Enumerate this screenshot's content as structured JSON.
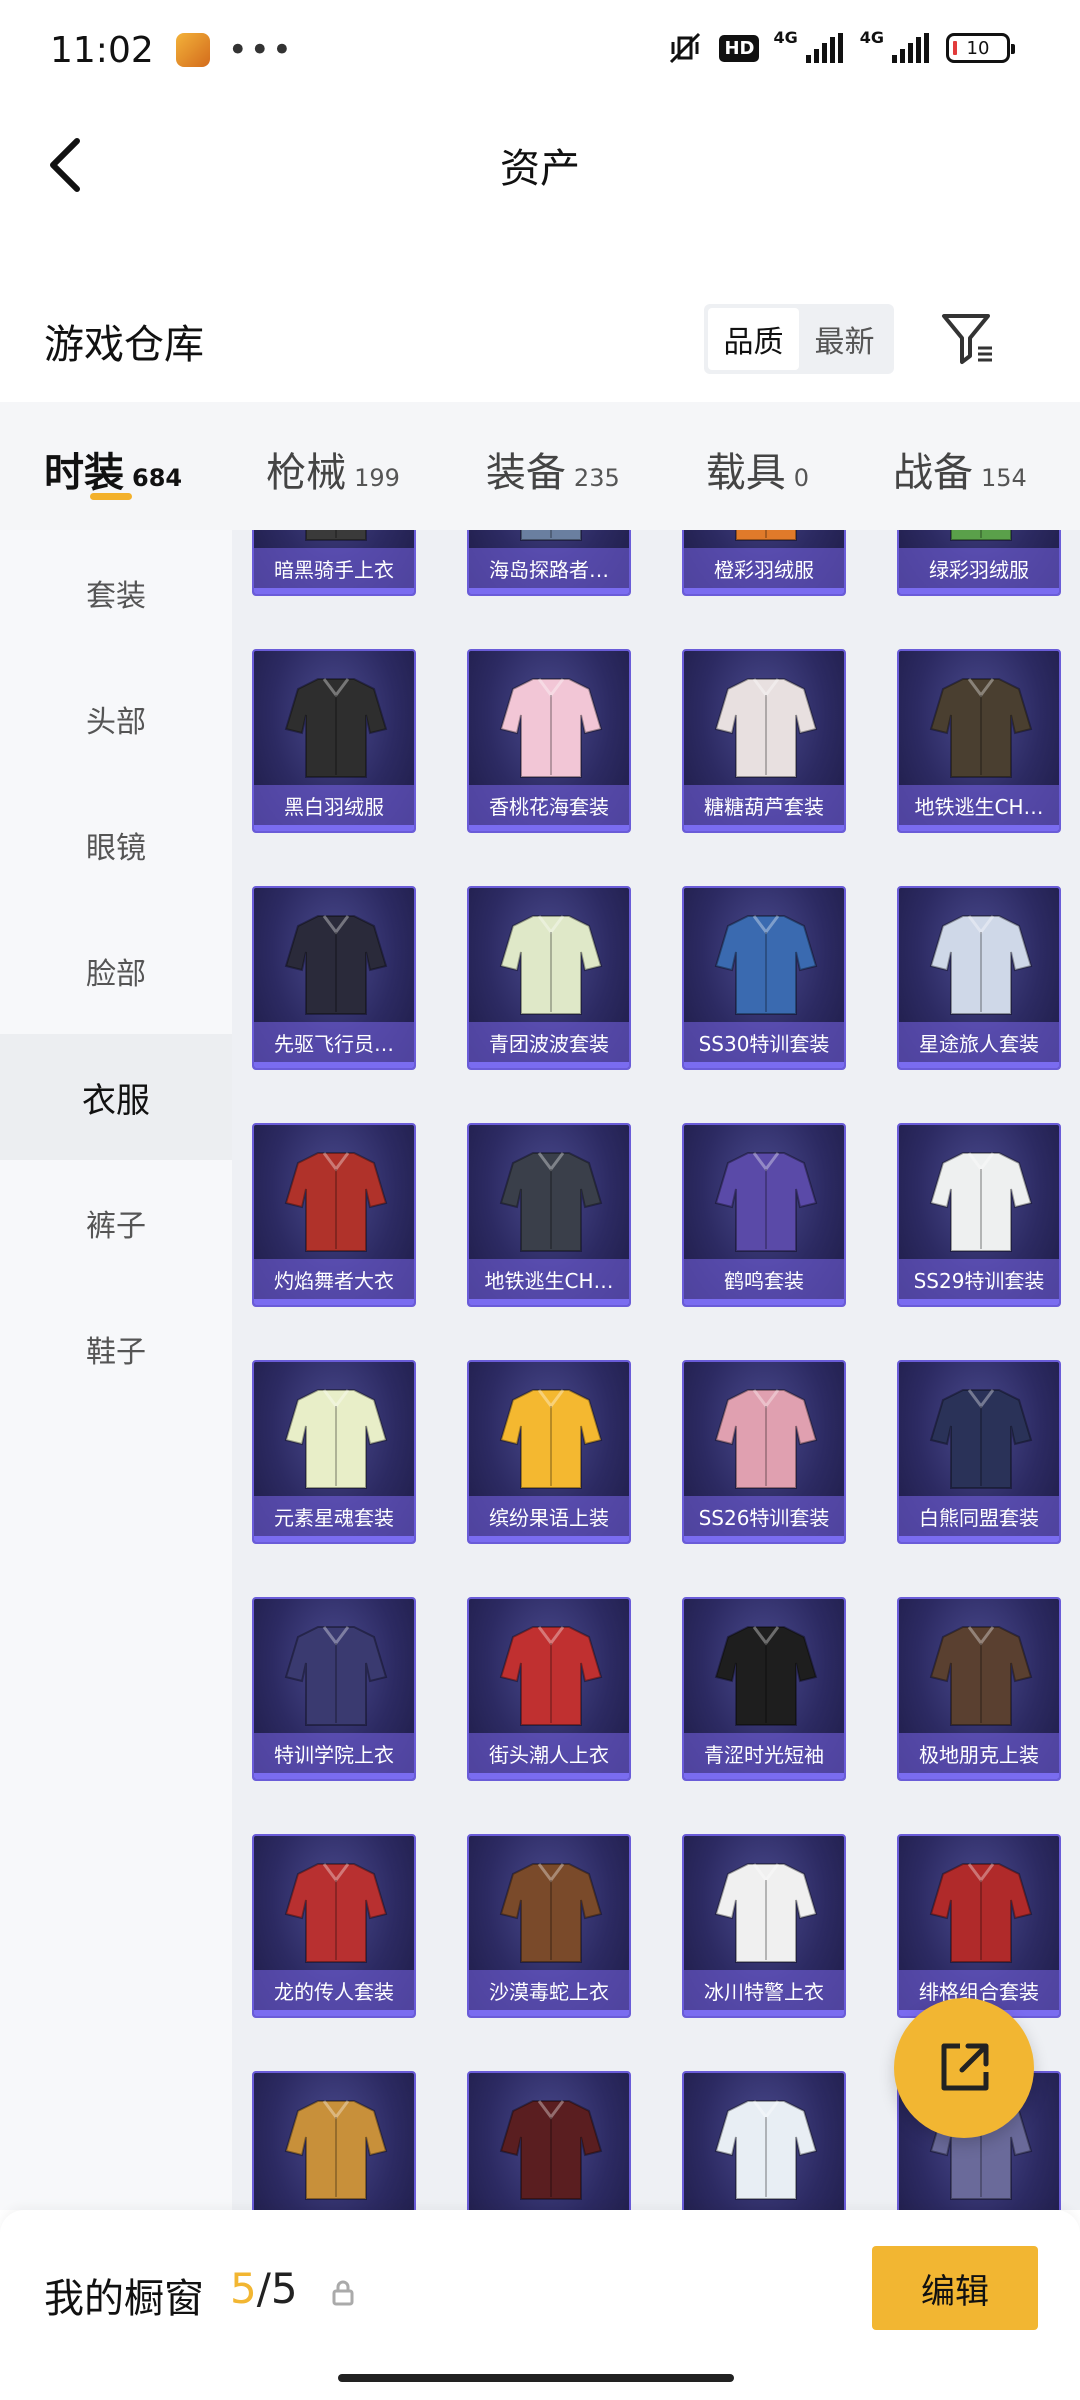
{
  "status_bar": {
    "time": "11:02",
    "more": "•••",
    "hd_badge": "HD",
    "net1": "4G",
    "net2": "4G",
    "battery": "10"
  },
  "nav": {
    "title": "资产"
  },
  "warehouse": {
    "title": "游戏仓库",
    "sort_options": [
      "品质",
      "最新"
    ],
    "active_sort": "品质"
  },
  "categories": [
    {
      "name": "时装",
      "count": "684",
      "active": true
    },
    {
      "name": "枪械",
      "count": "199"
    },
    {
      "name": "装备",
      "count": "235"
    },
    {
      "name": "载具",
      "count": "0"
    },
    {
      "name": "战备",
      "count": "154"
    }
  ],
  "sidebar": {
    "items": [
      "套装",
      "头部",
      "眼镜",
      "脸部",
      "衣服",
      "裤子",
      "鞋子"
    ],
    "active": "衣服"
  },
  "items": [
    "暗黑骑手上衣",
    "海岛探路者…",
    "橙彩羽绒服",
    "绿彩羽绒服",
    "黑白羽绒服",
    "香桃花海套装",
    "糖糖葫芦套装",
    "地铁逃生CH…",
    "先驱飞行员…",
    "青团波波套装",
    "SS30特训套装",
    "星途旅人套装",
    "灼焰舞者大衣",
    "地铁逃生CH…",
    "鹤鸣套装",
    "SS29特训套装",
    "元素星魂套装",
    "缤纷果语上装",
    "SS26特训套装",
    "白熊同盟套装",
    "特训学院上衣",
    "街头潮人上衣",
    "青涩时光短袖",
    "极地朋克上装",
    "龙的传人套装",
    "沙漠毒蛇上衣",
    "冰川特警上衣",
    "绯格组合套装",
    "",
    "",
    "",
    ""
  ],
  "item_colors": [
    "#3a3a3a",
    "#6a7fa0",
    "#e07a2a",
    "#5aa04a",
    "#2e2e2e",
    "#f2c6d6",
    "#e8e0e0",
    "#4a3f30",
    "#2a2a3a",
    "#dfe8c8",
    "#3a6ab0",
    "#cfd8e8",
    "#b0322a",
    "#3a3f4a",
    "#5a4aa8",
    "#eef0f0",
    "#e8eec8",
    "#f4b830",
    "#e0a0b0",
    "#2a3258",
    "#3a3a70",
    "#c03030",
    "#1e1e1e",
    "#5a4030",
    "#b83030",
    "#7a4a2a",
    "#f0f0f0",
    "#b02a2a",
    "#c8903a",
    "#5a1e20",
    "#e8eef4",
    "#6a6a9a"
  ],
  "wardrobe": {
    "label": "我的橱窗",
    "used": "5",
    "separator": "/",
    "total": "5",
    "edit": "编辑"
  }
}
